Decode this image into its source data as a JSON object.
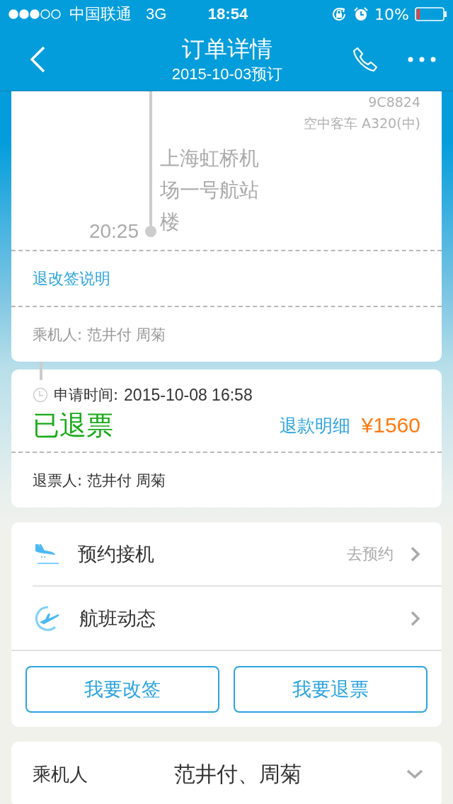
{
  "status_bar": {
    "carrier": "中国联通",
    "network": "3G",
    "time": "18:54",
    "battery": "10%"
  },
  "header": {
    "title": "订单详情",
    "subtitle": "2015-10-03预订"
  },
  "flight": {
    "flight_no": "9C8824",
    "aircraft": "空中客车 A320(中)",
    "arrive_time": "20:25",
    "arrive_airport": "上海虹桥机场一号航站楼",
    "rules_link": "退改签说明",
    "passengers": "乘机人: 范井付 周菊"
  },
  "refund": {
    "apply_label": "申请时间:",
    "apply_time": "2015-10-08 16:58",
    "status": "已退票",
    "detail_link": "退款明细",
    "amount": "¥1560",
    "refund_people": "退票人: 范井付 周菊"
  },
  "services": [
    {
      "kind": "pickup",
      "label": "预约接机",
      "action": "去预约"
    },
    {
      "kind": "status",
      "label": "航班动态"
    }
  ],
  "buttons": [
    "我要改签",
    "我要退票"
  ],
  "passenger_row": {
    "label": "乘机人",
    "value": "范井付、周菊",
    "expanded": false
  }
}
